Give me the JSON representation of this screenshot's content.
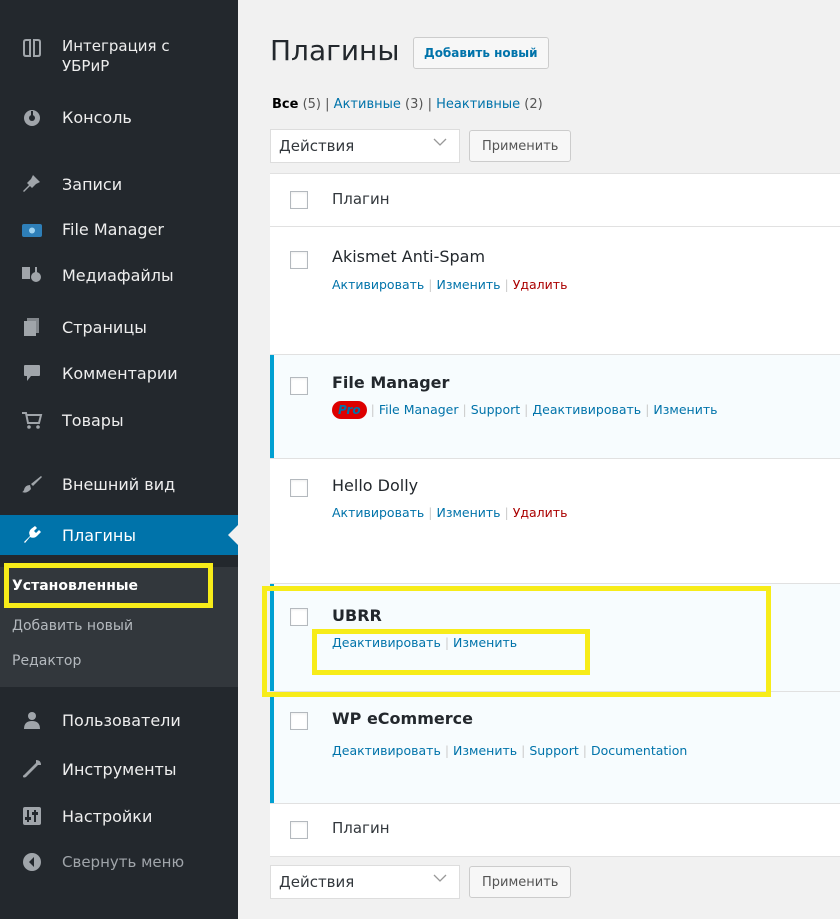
{
  "sidebar": {
    "items": [
      {
        "icon": "ubrir-icon",
        "label_line1": "Интеграция с",
        "label_line2": "УБРиР"
      },
      {
        "icon": "dashboard-icon",
        "label": "Консоль"
      },
      {
        "icon": "pin-icon",
        "label": "Записи"
      },
      {
        "icon": "file-manager-icon",
        "label": "File Manager"
      },
      {
        "icon": "media-icon",
        "label": "Медиафайлы"
      },
      {
        "icon": "pages-icon",
        "label": "Страницы"
      },
      {
        "icon": "comments-icon",
        "label": "Комментарии"
      },
      {
        "icon": "cart-icon",
        "label": "Товары"
      },
      {
        "icon": "appearance-icon",
        "label": "Внешний вид"
      },
      {
        "icon": "plugins-icon",
        "label": "Плагины"
      },
      {
        "icon": "users-icon",
        "label": "Пользователи"
      },
      {
        "icon": "tools-icon",
        "label": "Инструменты"
      },
      {
        "icon": "settings-icon",
        "label": "Настройки"
      },
      {
        "icon": "collapse-icon",
        "label": "Свернуть меню"
      }
    ],
    "submenu": [
      {
        "label": "Установленные"
      },
      {
        "label": "Добавить новый"
      },
      {
        "label": "Редактор"
      }
    ]
  },
  "header": {
    "title": "Плагины",
    "add_new": "Добавить новый"
  },
  "filters": {
    "all_label": "Все",
    "all_count": "(5)",
    "active_label": "Активные",
    "active_count": "(3)",
    "inactive_label": "Неактивные",
    "inactive_count": "(2)",
    "sep": "|"
  },
  "bulk": {
    "select_value": "Действия",
    "apply": "Применить"
  },
  "table": {
    "column_header": "Плагин",
    "plugins": [
      {
        "name": "Akismet Anti-Spam",
        "actions": [
          "Активировать",
          "Изменить",
          "Удалить"
        ]
      },
      {
        "name": "File Manager",
        "badge": "Pro",
        "actions": [
          "File Manager",
          "Support",
          "Деактивировать",
          "Изменить"
        ]
      },
      {
        "name": "Hello Dolly",
        "actions": [
          "Активировать",
          "Изменить",
          "Удалить"
        ]
      },
      {
        "name": "UBRR",
        "actions": [
          "Деактивировать",
          "Изменить"
        ]
      },
      {
        "name": "WP eCommerce",
        "actions": [
          "Деактивировать",
          "Изменить",
          "Support",
          "Documentation"
        ]
      }
    ]
  },
  "colors": {
    "sidebar_bg": "#23282d",
    "accent": "#0073aa",
    "highlight": "#f7ec19",
    "delete": "#aa0000",
    "active_border": "#00a0d2"
  }
}
